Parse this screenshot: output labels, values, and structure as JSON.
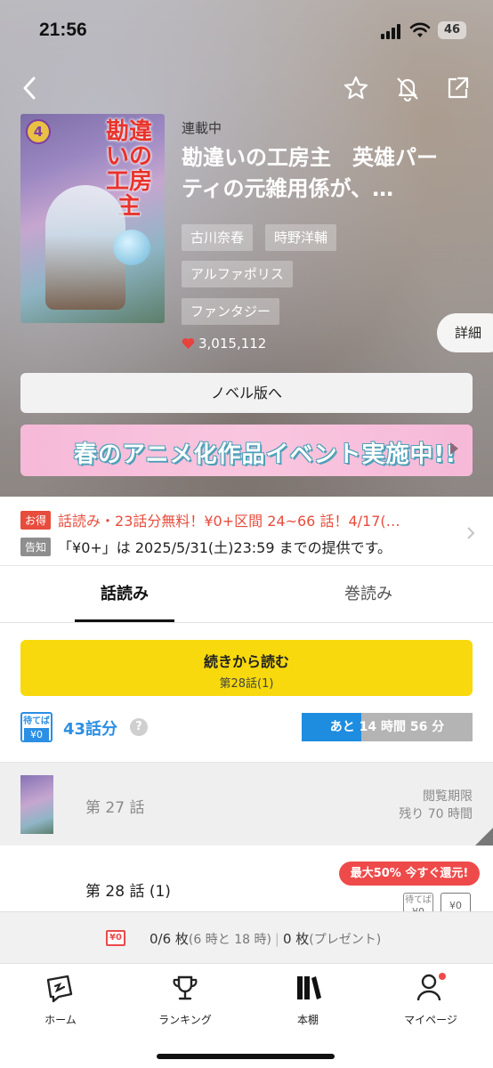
{
  "status": {
    "time": "21:56",
    "battery": "46"
  },
  "hero": {
    "status_label": "連載中",
    "title": "勘違いの工房主　英雄パーティの元雑用係が、…",
    "tags": [
      "古川奈春",
      "時野洋輔",
      "アルファポリス",
      "ファンタジー"
    ],
    "likes": "3,015,112",
    "detail_label": "詳細",
    "cover_title": "勘違いの工房主",
    "cover_volume": "4"
  },
  "novel_button": "ノベル版へ",
  "banner": {
    "text": "春のアニメ化作品イベント実施中!!"
  },
  "notices": [
    {
      "badge": "お得",
      "text": "話読み・23話分無料！¥0+区間 24~66 話！4/17(…"
    },
    {
      "badge": "告知",
      "text": "「¥0+」は 2025/5/31(土)23:59 までの提供です。"
    }
  ],
  "tabs": {
    "episodes": "話読み",
    "volumes": "巻読み"
  },
  "continue": {
    "label": "続きから読む",
    "sub": "第28話(1)"
  },
  "wait_free": {
    "badge_top": "待てば",
    "badge_bottom": "¥0",
    "count": "43話分",
    "help": "?",
    "timer": "あと 14 時間 56 分",
    "progress": 0.35
  },
  "episodes": [
    {
      "title": "第 27 話",
      "meta1": "閲覧期限",
      "meta2": "残り 70 時間"
    },
    {
      "title": "第 28 話 (1)",
      "promo": "最大50% 今すぐ還元!",
      "badge1_top": "待てば",
      "badge1_bottom": "¥0",
      "badge2": "¥0"
    }
  ],
  "ticket": {
    "icon": "¥0",
    "count": "0/6 枚",
    "times": "(6 時と 18 時)",
    "present_count": "0 枚",
    "present_label": "(プレゼント)"
  },
  "tabbar": [
    {
      "label": "ホーム",
      "icon": "home-icon"
    },
    {
      "label": "ランキング",
      "icon": "trophy-icon"
    },
    {
      "label": "本棚",
      "icon": "bookshelf-icon"
    },
    {
      "label": "マイページ",
      "icon": "person-icon"
    }
  ],
  "colors": {
    "accent_yellow": "#f7d90d",
    "wait_blue": "#1e8de0",
    "promo_red": "#ef4a4a"
  }
}
